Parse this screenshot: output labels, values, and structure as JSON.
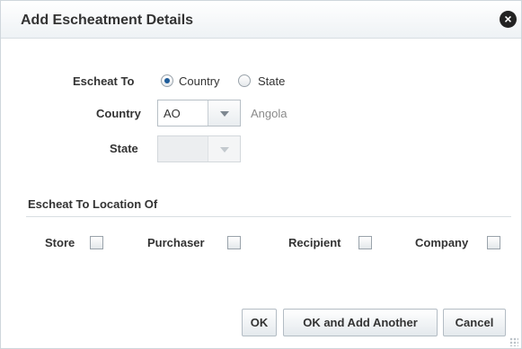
{
  "dialog": {
    "title": "Add Escheatment Details",
    "close_icon": "close-icon"
  },
  "form": {
    "escheat_to_label": "Escheat To",
    "escheat_options": [
      {
        "label": "Country",
        "selected": true
      },
      {
        "label": "State",
        "selected": false
      }
    ],
    "country_label": "Country",
    "country_value": "AO",
    "country_description": "Angola",
    "state_label": "State",
    "state_value": "",
    "state_disabled": true
  },
  "location_section": {
    "title": "Escheat To Location Of",
    "options": [
      {
        "label": "Store",
        "checked": false
      },
      {
        "label": "Purchaser",
        "checked": false
      },
      {
        "label": "Recipient",
        "checked": false
      },
      {
        "label": "Company",
        "checked": false
      }
    ]
  },
  "buttons": {
    "ok": "OK",
    "ok_add_another": "OK and Add Another",
    "cancel": "Cancel"
  },
  "colors": {
    "header_bg": "#eef2f5",
    "radio_selected": "#1e5c99",
    "muted_text": "#8a8a8a"
  }
}
